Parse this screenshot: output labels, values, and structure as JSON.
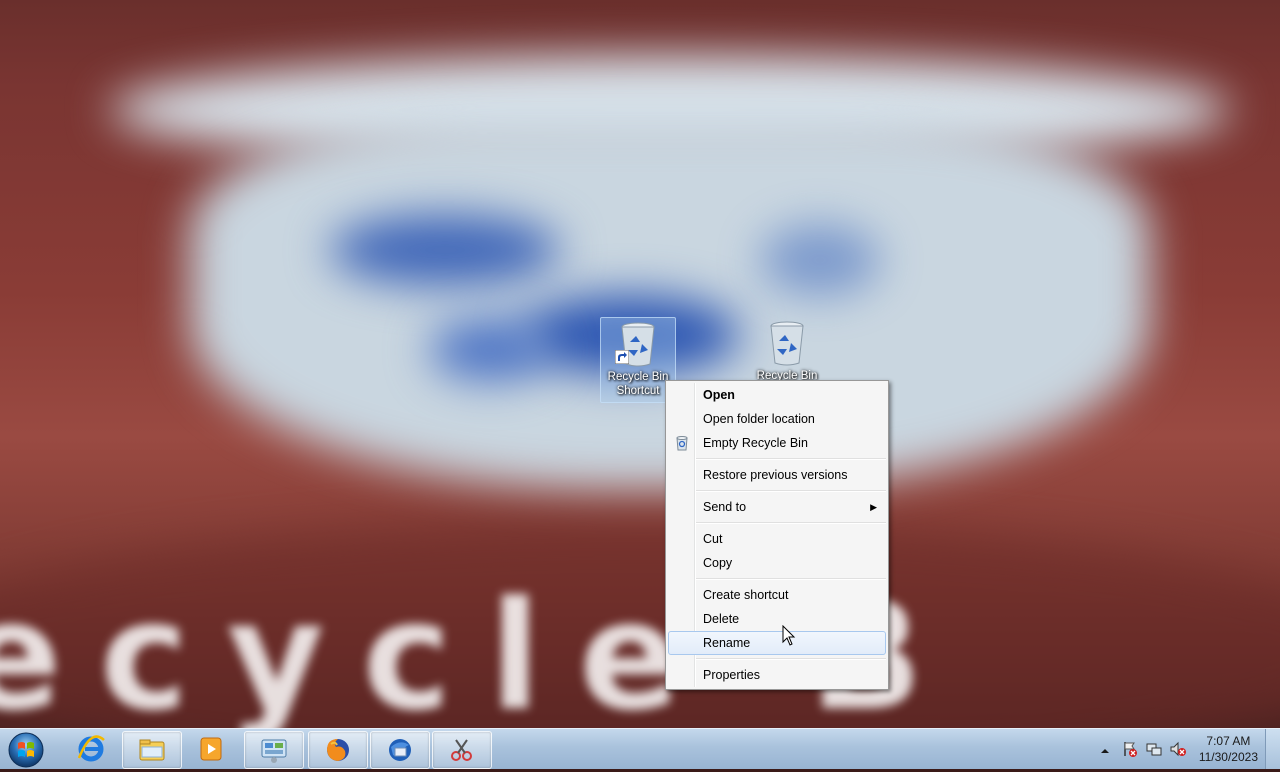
{
  "desktop": {
    "icons": [
      {
        "name": "Recycle Bin Shortcut",
        "label_line1": "Recycle Bin",
        "label_line2": "Shortcut",
        "selected": true
      },
      {
        "name": "Recycle Bin",
        "label_line1": "Recycle Bin",
        "label_line2": "",
        "selected": false
      }
    ],
    "wallpaper_text": "ecycle B"
  },
  "context_menu": {
    "open": "Open",
    "open_folder_location": "Open folder location",
    "empty_recycle_bin": "Empty Recycle Bin",
    "restore_previous_versions": "Restore previous versions",
    "send_to": "Send to",
    "cut": "Cut",
    "copy": "Copy",
    "create_shortcut": "Create shortcut",
    "delete": "Delete",
    "rename": "Rename",
    "properties": "Properties",
    "hovered_item": "Rename"
  },
  "taskbar": {
    "pinned": [
      {
        "name": "internet-explorer-icon"
      },
      {
        "name": "windows-explorer-icon"
      },
      {
        "name": "media-player-icon"
      },
      {
        "name": "control-panel-icon"
      },
      {
        "name": "firefox-icon"
      },
      {
        "name": "thunderbird-icon"
      },
      {
        "name": "snipping-tool-icon"
      }
    ],
    "clock": {
      "time": "7:07 AM",
      "date": "11/30/2023"
    }
  },
  "colors": {
    "taskbar": "#a9c2dc",
    "menu_bg": "#f5f5f5",
    "menu_hover": "#e2ecf9",
    "selection": "#aacdf0"
  }
}
